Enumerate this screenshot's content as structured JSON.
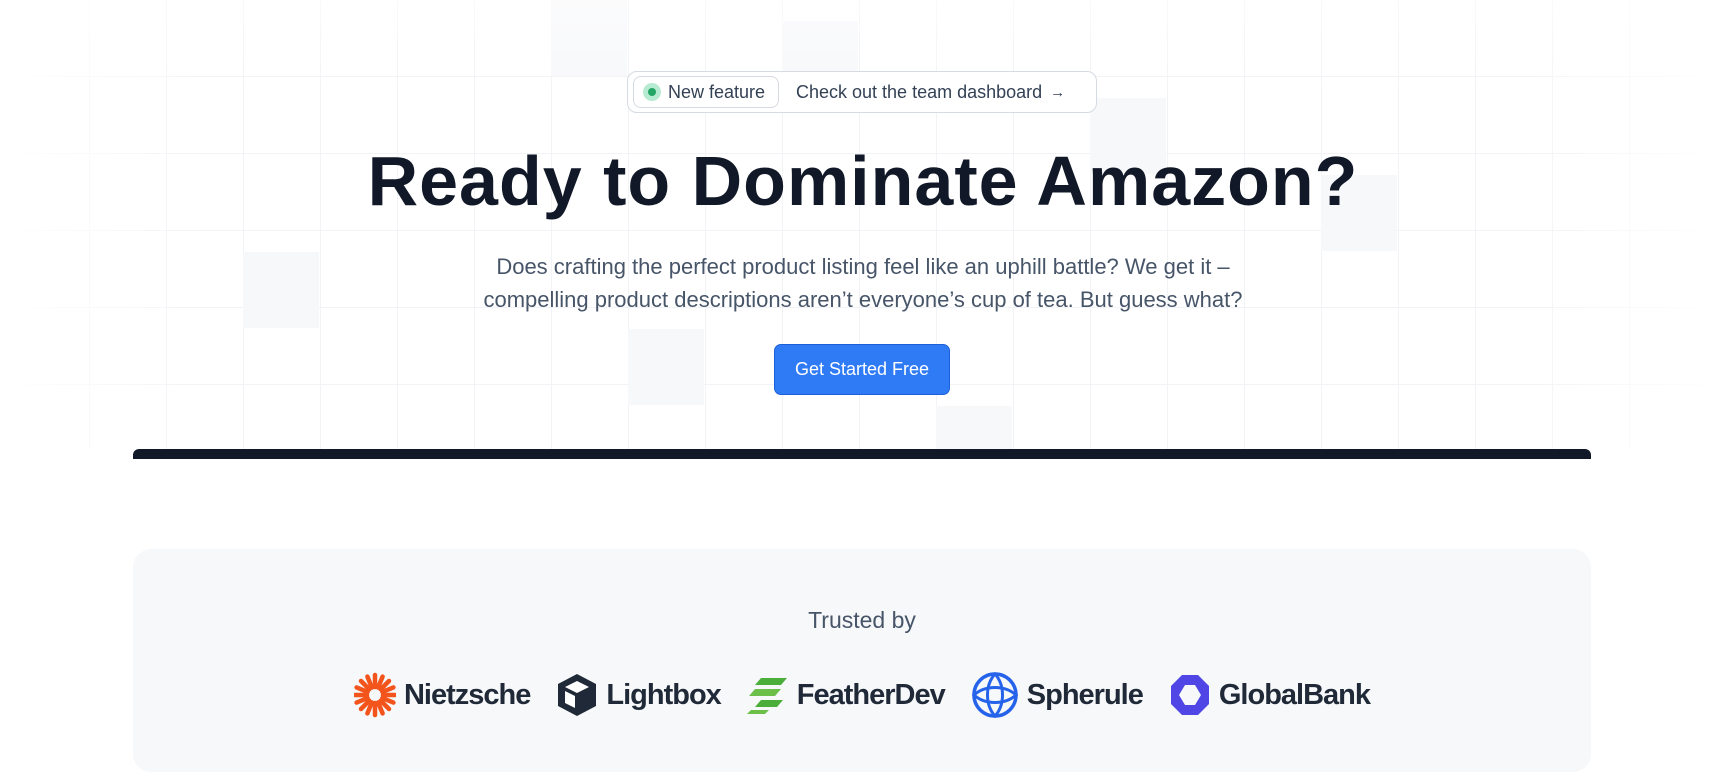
{
  "announcement": {
    "badge_label": "New feature",
    "link_text": "Check out the team dashboard",
    "arrow_icon": "arrow-right-icon"
  },
  "hero": {
    "headline": "Ready to Dominate Amazon?",
    "subtitle_line1": "Does crafting the perfect product listing feel like an uphill battle? We get it –",
    "subtitle_line2": "compelling product descriptions aren’t everyone’s cup of tea. But guess what?",
    "cta_label": "Get Started Free"
  },
  "trusted": {
    "title": "Trusted by",
    "logos": [
      {
        "name": "Nietzsche",
        "icon": "sunburst-icon",
        "color": "#f2541b"
      },
      {
        "name": "Lightbox",
        "icon": "cube-icon",
        "color": "#1f2937"
      },
      {
        "name": "FeatherDev",
        "icon": "feather-icon",
        "color": "#4cae3a"
      },
      {
        "name": "Spherule",
        "icon": "sphere-icon",
        "color": "#2563eb"
      },
      {
        "name": "GlobalBank",
        "icon": "octagon-icon",
        "color": "#4f46e5"
      }
    ]
  },
  "colors": {
    "accent": "#2f7bf6",
    "heading": "#111827",
    "body_text": "#475569",
    "status_dot": "#22a565"
  }
}
